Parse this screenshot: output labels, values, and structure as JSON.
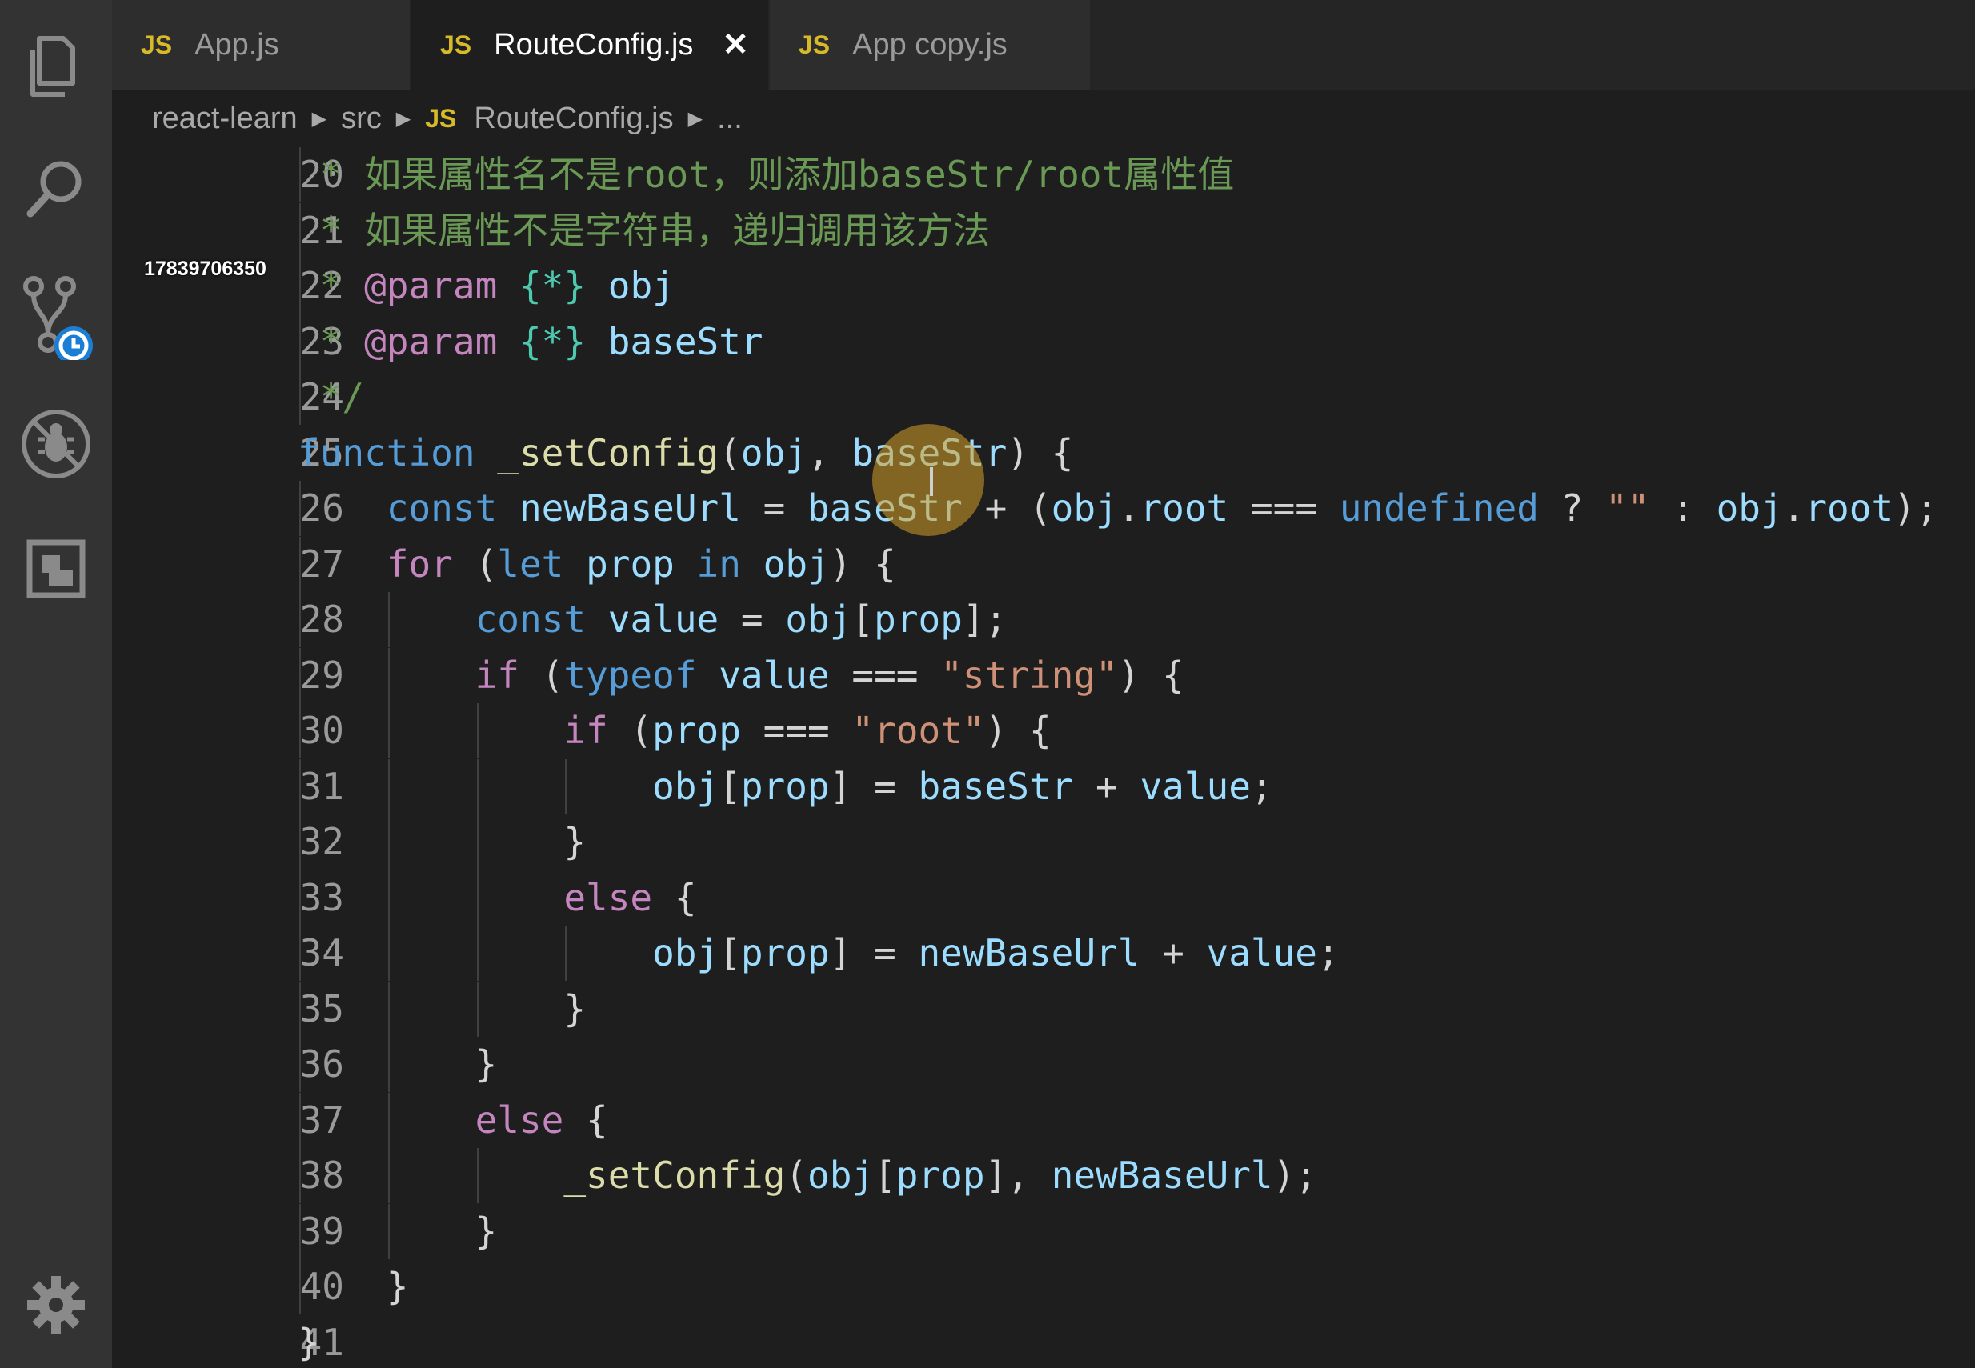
{
  "tabs": [
    {
      "badge": "JS",
      "name": "App.js",
      "active": false
    },
    {
      "badge": "JS",
      "name": "RouteConfig.js",
      "active": true,
      "close": "✕"
    },
    {
      "badge": "JS",
      "name": "App copy.js",
      "active": false
    }
  ],
  "breadcrumb": {
    "folder": "react-learn",
    "subfolder": "src",
    "badge": "JS",
    "file": "RouteConfig.js",
    "more": "..."
  },
  "activity_icons": [
    "explorer-icon",
    "search-icon",
    "source-control-icon",
    "debug-icon",
    "extensions-icon",
    "gear-icon"
  ],
  "watermark": "17839706350",
  "editor": {
    "lines": [
      {
        "n": "20",
        "tokens": [
          [
            " * 如果属性名不是root，则添加baseStr/root属性值",
            "cm"
          ]
        ]
      },
      {
        "n": "21",
        "tokens": [
          [
            " * 如果属性不是字符串，递归调用该方法",
            "cm"
          ]
        ]
      },
      {
        "n": "22",
        "tokens": [
          [
            " * ",
            "cm"
          ],
          [
            "@param",
            "ctl"
          ],
          [
            " ",
            "cm"
          ],
          [
            "{*}",
            "tg"
          ],
          [
            " obj",
            "vr"
          ]
        ]
      },
      {
        "n": "23",
        "tokens": [
          [
            " * ",
            "cm"
          ],
          [
            "@param",
            "ctl"
          ],
          [
            " ",
            "cm"
          ],
          [
            "{*}",
            "tg"
          ],
          [
            " baseStr",
            "vr"
          ]
        ]
      },
      {
        "n": "24",
        "tokens": [
          [
            " */",
            "cm"
          ]
        ]
      },
      {
        "n": "25",
        "tokens": [
          [
            "function",
            "kw"
          ],
          [
            " ",
            "pn"
          ],
          [
            "_setConfig",
            "fn"
          ],
          [
            "(",
            "pn"
          ],
          [
            "obj",
            "vr"
          ],
          [
            ", ",
            "pn"
          ],
          [
            "baseStr",
            "vr"
          ],
          [
            ") {",
            "pn"
          ]
        ]
      },
      {
        "n": "26",
        "tokens": [
          [
            "    ",
            "pn"
          ],
          [
            "const",
            "kw"
          ],
          [
            " ",
            "pn"
          ],
          [
            "newBaseUrl",
            "vr"
          ],
          [
            " = ",
            "pn"
          ],
          [
            "baseStr",
            "vr"
          ],
          [
            " + (",
            "pn"
          ],
          [
            "obj",
            "vr"
          ],
          [
            ".",
            "pn"
          ],
          [
            "root",
            "vr"
          ],
          [
            " === ",
            "pn"
          ],
          [
            "undefined",
            "kw"
          ],
          [
            " ? ",
            "pn"
          ],
          [
            "\"\"",
            "st"
          ],
          [
            " : ",
            "pn"
          ],
          [
            "obj",
            "vr"
          ],
          [
            ".",
            "pn"
          ],
          [
            "root",
            "vr"
          ],
          [
            ");",
            "pn"
          ]
        ]
      },
      {
        "n": "27",
        "tokens": [
          [
            "    ",
            "pn"
          ],
          [
            "for",
            "ctl"
          ],
          [
            " (",
            "pn"
          ],
          [
            "let",
            "kw"
          ],
          [
            " ",
            "pn"
          ],
          [
            "prop",
            "vr"
          ],
          [
            " ",
            "pn"
          ],
          [
            "in",
            "kw"
          ],
          [
            " ",
            "pn"
          ],
          [
            "obj",
            "vr"
          ],
          [
            ") {",
            "pn"
          ]
        ]
      },
      {
        "n": "28",
        "tokens": [
          [
            "        ",
            "pn"
          ],
          [
            "const",
            "kw"
          ],
          [
            " ",
            "pn"
          ],
          [
            "value",
            "vr"
          ],
          [
            " = ",
            "pn"
          ],
          [
            "obj",
            "vr"
          ],
          [
            "[",
            "pn"
          ],
          [
            "prop",
            "vr"
          ],
          [
            "];",
            "pn"
          ]
        ]
      },
      {
        "n": "29",
        "tokens": [
          [
            "        ",
            "pn"
          ],
          [
            "if",
            "ctl"
          ],
          [
            " (",
            "pn"
          ],
          [
            "typeof",
            "kw"
          ],
          [
            " ",
            "pn"
          ],
          [
            "value",
            "vr"
          ],
          [
            " === ",
            "pn"
          ],
          [
            "\"string\"",
            "st"
          ],
          [
            ") {",
            "pn"
          ]
        ]
      },
      {
        "n": "30",
        "tokens": [
          [
            "            ",
            "pn"
          ],
          [
            "if",
            "ctl"
          ],
          [
            " (",
            "pn"
          ],
          [
            "prop",
            "vr"
          ],
          [
            " === ",
            "pn"
          ],
          [
            "\"root\"",
            "st"
          ],
          [
            ") {",
            "pn"
          ]
        ]
      },
      {
        "n": "31",
        "tokens": [
          [
            "                ",
            "pn"
          ],
          [
            "obj",
            "vr"
          ],
          [
            "[",
            "pn"
          ],
          [
            "prop",
            "vr"
          ],
          [
            "] = ",
            "pn"
          ],
          [
            "baseStr",
            "vr"
          ],
          [
            " + ",
            "pn"
          ],
          [
            "value",
            "vr"
          ],
          [
            ";",
            "pn"
          ]
        ]
      },
      {
        "n": "32",
        "tokens": [
          [
            "            }",
            "pn"
          ]
        ]
      },
      {
        "n": "33",
        "tokens": [
          [
            "            ",
            "pn"
          ],
          [
            "else",
            "ctl"
          ],
          [
            " {",
            "pn"
          ]
        ]
      },
      {
        "n": "34",
        "tokens": [
          [
            "                ",
            "pn"
          ],
          [
            "obj",
            "vr"
          ],
          [
            "[",
            "pn"
          ],
          [
            "prop",
            "vr"
          ],
          [
            "] = ",
            "pn"
          ],
          [
            "newBaseUrl",
            "vr"
          ],
          [
            " + ",
            "pn"
          ],
          [
            "value",
            "vr"
          ],
          [
            ";",
            "pn"
          ]
        ]
      },
      {
        "n": "35",
        "tokens": [
          [
            "            }",
            "pn"
          ]
        ]
      },
      {
        "n": "36",
        "tokens": [
          [
            "        }",
            "pn"
          ]
        ]
      },
      {
        "n": "37",
        "tokens": [
          [
            "        ",
            "pn"
          ],
          [
            "else",
            "ctl"
          ],
          [
            " {",
            "pn"
          ]
        ]
      },
      {
        "n": "38",
        "tokens": [
          [
            "            ",
            "pn"
          ],
          [
            "_setConfig",
            "fn"
          ],
          [
            "(",
            "pn"
          ],
          [
            "obj",
            "vr"
          ],
          [
            "[",
            "pn"
          ],
          [
            "prop",
            "vr"
          ],
          [
            "], ",
            "pn"
          ],
          [
            "newBaseUrl",
            "vr"
          ],
          [
            ");",
            "pn"
          ]
        ]
      },
      {
        "n": "39",
        "tokens": [
          [
            "        }",
            "pn"
          ]
        ]
      },
      {
        "n": "40",
        "tokens": [
          [
            "    }",
            "pn"
          ]
        ]
      },
      {
        "n": "41",
        "tokens": [
          [
            "}",
            "pn"
          ]
        ]
      }
    ]
  }
}
